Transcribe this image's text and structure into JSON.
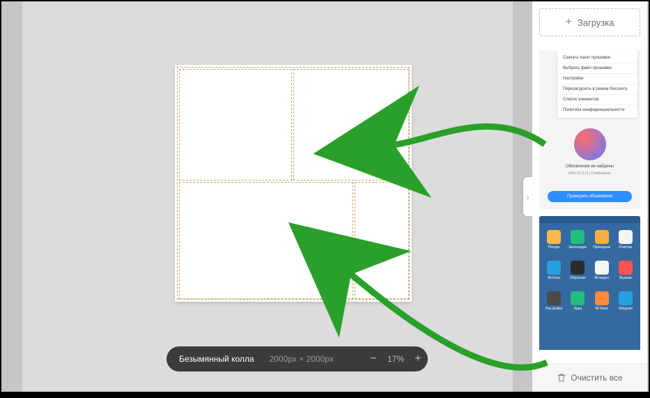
{
  "zoombar": {
    "name": "Безымянный колла",
    "size": "2000px × 2000px",
    "zoom_percent": "17%"
  },
  "sidebar": {
    "upload_label": "Загрузка",
    "clear_label": "Очистить все"
  },
  "thumb1": {
    "menu": [
      "Скачать пакет прошивки",
      "Выбрать файл прошивки",
      "Настройки",
      "Перезагрузить в режим Recovery",
      "Список элементов",
      "Политика конфиденциальности"
    ],
    "title": "Обновления не найдены",
    "subtitle": "MIUI 11 9.12 | Стабильная",
    "button": "Проверить обновления"
  },
  "thumb2": {
    "apps": [
      {
        "label": "Погода",
        "color": "#ffb84d"
      },
      {
        "label": "Календарь",
        "color": "#1fbf7b"
      },
      {
        "label": "Проводник",
        "color": "#f6b042"
      },
      {
        "label": "Очистка",
        "color": "#f5f5f5"
      },
      {
        "label": "Mi Drop",
        "color": "#28a0e0"
      },
      {
        "label": "Обратная",
        "color": "#2c2c2c"
      },
      {
        "label": "Mi видео",
        "color": "#f5f5f5"
      },
      {
        "label": "Музыка",
        "color": "#ff5252"
      },
      {
        "label": "Настройки",
        "color": "#4a4a4a"
      },
      {
        "label": "Apps",
        "color": "#1fbf7b"
      },
      {
        "label": "Mi Store",
        "color": "#ff8a3d"
      },
      {
        "label": "Telegram",
        "color": "#28a0e0"
      }
    ]
  }
}
